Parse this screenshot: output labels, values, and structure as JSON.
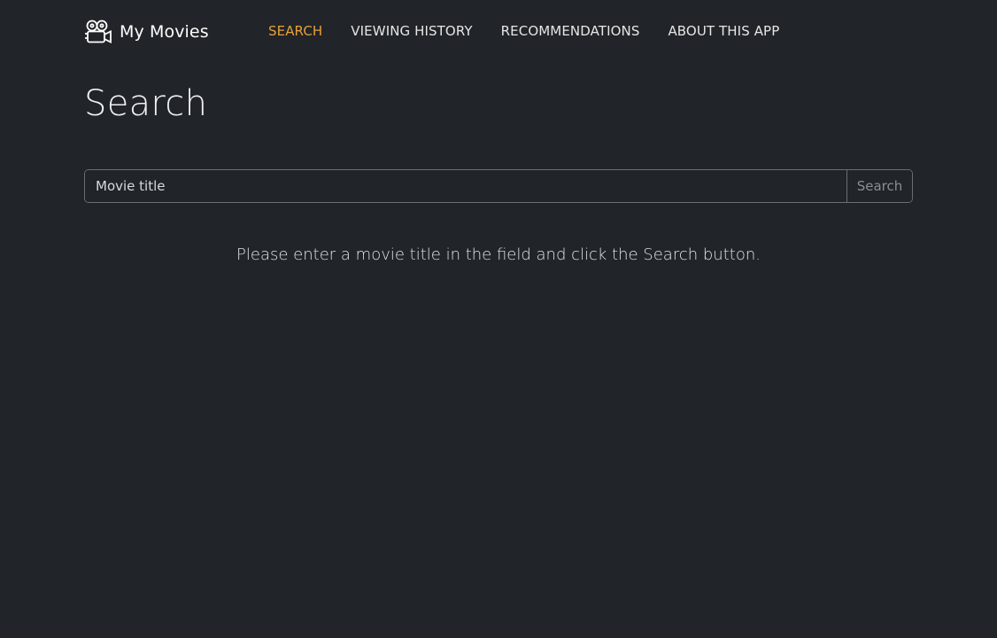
{
  "navbar": {
    "brand_icon": "movie-camera-icon",
    "brand_label": "My Movies",
    "links": [
      {
        "label": "SEARCH",
        "active": true
      },
      {
        "label": "VIEWING HISTORY",
        "active": false
      },
      {
        "label": "RECOMMENDATIONS",
        "active": false
      },
      {
        "label": "ABOUT THIS APP",
        "active": false
      }
    ],
    "active_color": "#e8a03a"
  },
  "page": {
    "title": "Search"
  },
  "search": {
    "placeholder": "Movie title",
    "value": "",
    "button_label": "Search"
  },
  "hint": "Please enter a movie title in the field and click the Search button.",
  "colors": {
    "background": "#212428",
    "text": "#e6e6e6",
    "accent": "#e8a03a",
    "border": "#6a6f76"
  }
}
